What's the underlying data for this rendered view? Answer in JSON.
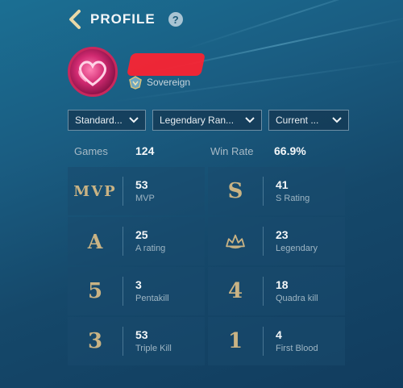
{
  "header": {
    "title": "PROFILE",
    "help_label": "?"
  },
  "profile": {
    "rank_name": "Sovereign"
  },
  "filters": [
    {
      "label": "Standard..."
    },
    {
      "label": "Legendary Ran..."
    },
    {
      "label": "Current ..."
    }
  ],
  "summary": {
    "games_label": "Games",
    "games_value": "124",
    "winrate_label": "Win Rate",
    "winrate_value": "66.9%"
  },
  "stats": [
    {
      "icon_text": "MVP",
      "value": "53",
      "label": "MVP"
    },
    {
      "icon_text": "S",
      "value": "41",
      "label": "S Rating"
    },
    {
      "icon_text": "A",
      "value": "25",
      "label": "A rating"
    },
    {
      "icon_text": "",
      "icon": "legendary-crown-icon",
      "value": "23",
      "label": "Legendary"
    },
    {
      "icon_text": "5",
      "value": "3",
      "label": "Pentakill"
    },
    {
      "icon_text": "4",
      "value": "18",
      "label": "Quadra kill"
    },
    {
      "icon_text": "3",
      "value": "53",
      "label": "Triple Kill"
    },
    {
      "icon_text": "1",
      "value": "4",
      "label": "First Blood"
    }
  ],
  "colors": {
    "accent_gold": "#c9b384",
    "background": "#1a5d82",
    "avatar_ring": "#c9285d"
  }
}
